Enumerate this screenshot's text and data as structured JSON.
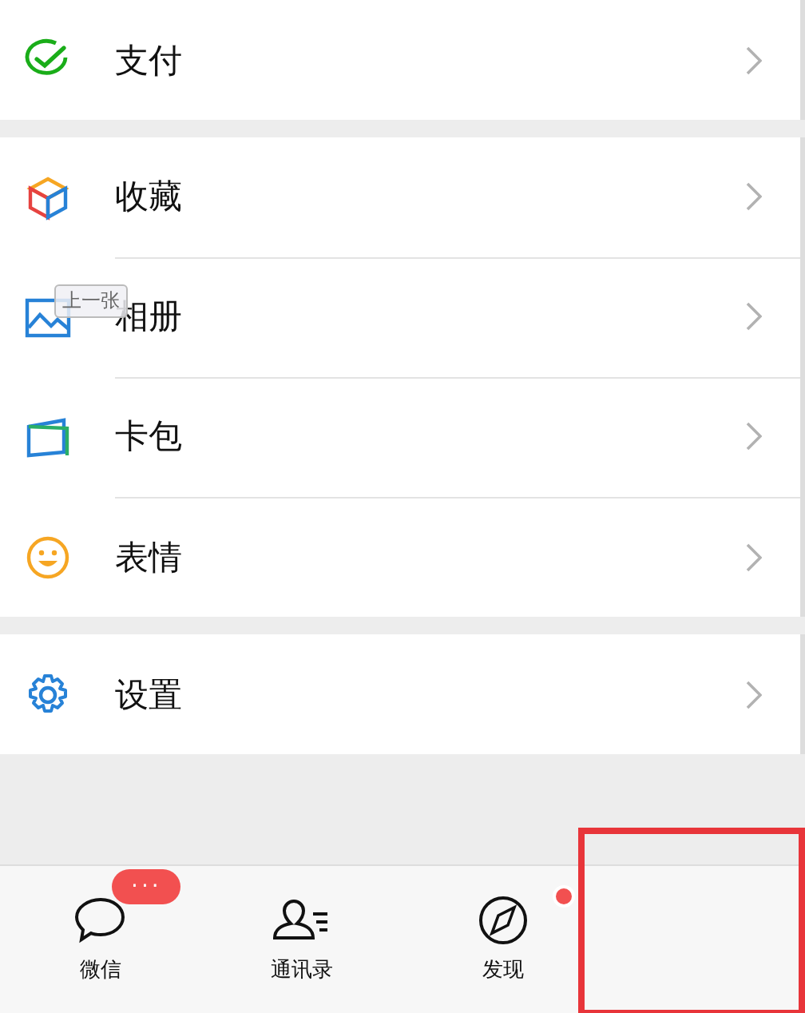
{
  "groups": [
    {
      "rows": [
        {
          "label": "支付"
        }
      ]
    },
    {
      "rows": [
        {
          "label": "收藏"
        },
        {
          "label": "相册",
          "tooltip": "上一张"
        },
        {
          "label": "卡包"
        },
        {
          "label": "表情"
        }
      ]
    },
    {
      "rows": [
        {
          "label": "设置"
        }
      ]
    }
  ],
  "tab_bar": {
    "tabs": [
      {
        "label": "微信",
        "badge": "···",
        "dot": false
      },
      {
        "label": "通讯录",
        "dot": false
      },
      {
        "label": "发现",
        "dot": true
      }
    ]
  },
  "highlight_frame": true
}
